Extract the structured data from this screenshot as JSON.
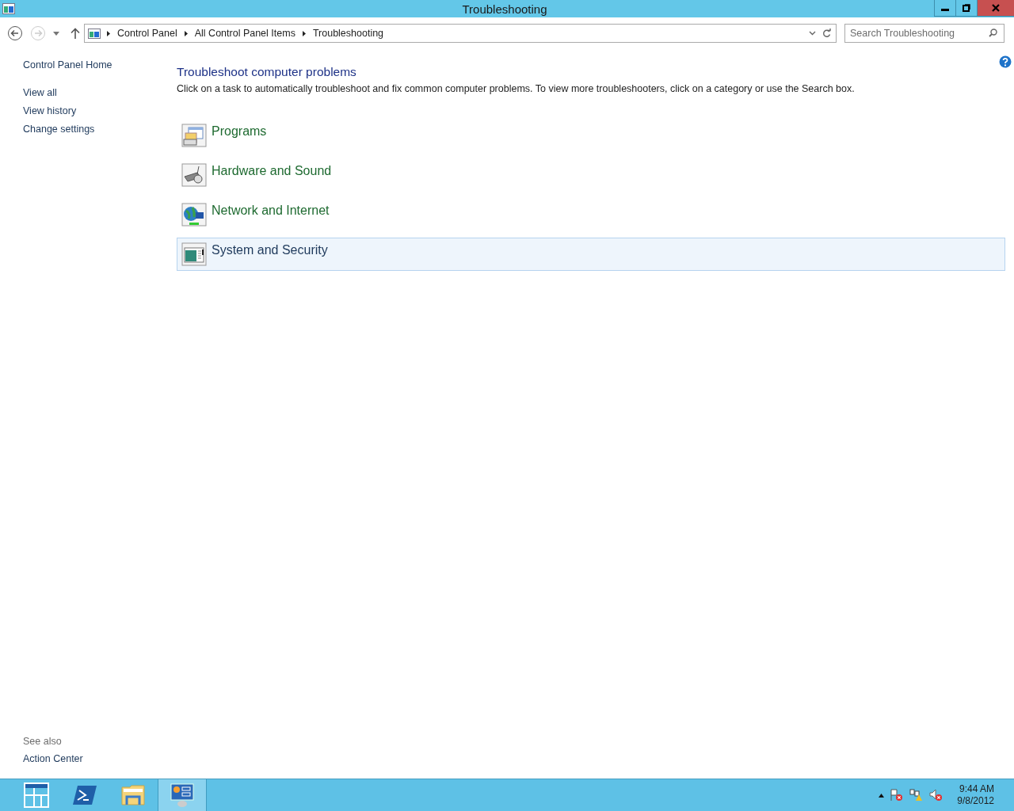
{
  "window": {
    "title": "Troubleshooting"
  },
  "address_bar": {
    "breadcrumbs": [
      "Control Panel",
      "All Control Panel Items",
      "Troubleshooting"
    ]
  },
  "search": {
    "placeholder": "Search Troubleshooting"
  },
  "sidebar": {
    "items": [
      "Control Panel Home",
      "View all",
      "View history",
      "Change settings"
    ],
    "see_also": {
      "heading": "See also",
      "items": [
        "Action Center"
      ]
    }
  },
  "content": {
    "heading": "Troubleshoot computer problems",
    "description": "Click on a task to automatically troubleshoot and fix common computer problems. To view more troubleshooters, click on a category or use the Search box.",
    "categories": [
      {
        "label": "Programs",
        "kind": "programs",
        "highlighted": false
      },
      {
        "label": "Hardware and Sound",
        "kind": "hardware",
        "highlighted": false
      },
      {
        "label": "Network and Internet",
        "kind": "network",
        "highlighted": false
      },
      {
        "label": "System and Security",
        "kind": "system",
        "highlighted": true
      }
    ]
  },
  "taskbar": {
    "apps": [
      {
        "kind": "start",
        "selected": false
      },
      {
        "kind": "powershell",
        "selected": false
      },
      {
        "kind": "explorer",
        "selected": false
      },
      {
        "kind": "control-panel",
        "selected": true
      }
    ],
    "tray": {
      "time": "9:44 AM",
      "date": "9/8/2012"
    }
  }
}
